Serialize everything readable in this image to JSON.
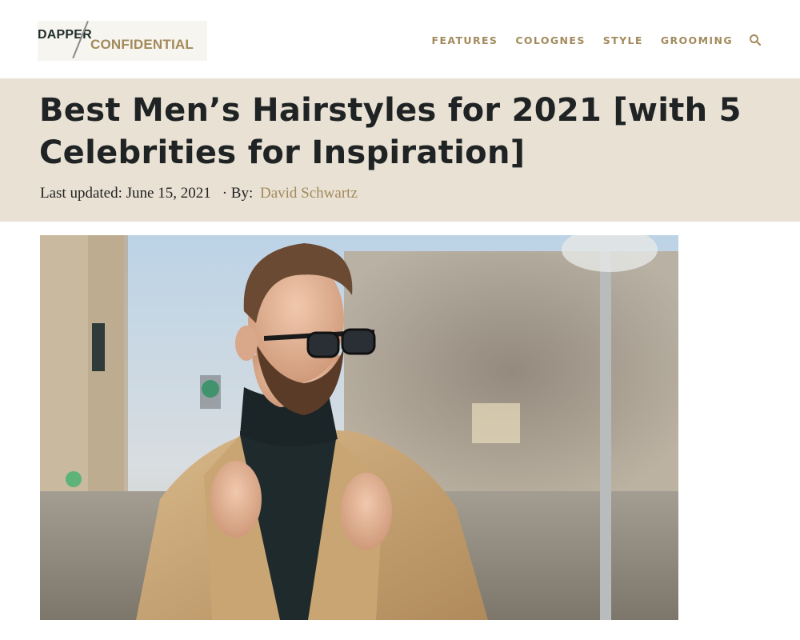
{
  "header": {
    "logo": {
      "line1": "DAPPER",
      "line2": "CONFIDENTIAL"
    },
    "nav": [
      {
        "label": "FEATURES"
      },
      {
        "label": "COLOGNES"
      },
      {
        "label": "STYLE"
      },
      {
        "label": "GROOMING"
      }
    ],
    "search_icon": "search-icon"
  },
  "article": {
    "title_line1": "Best Men’s Hairstyles for 2021 [with 5",
    "title_line2": "Celebrities for Inspiration]",
    "updated_label": "Last updated: June 15, 2021",
    "by_label": "· By:",
    "author": "David Schwartz"
  },
  "colors": {
    "accent": "#a38a5c",
    "band": "#e8e1d4",
    "title": "#1f2324"
  }
}
